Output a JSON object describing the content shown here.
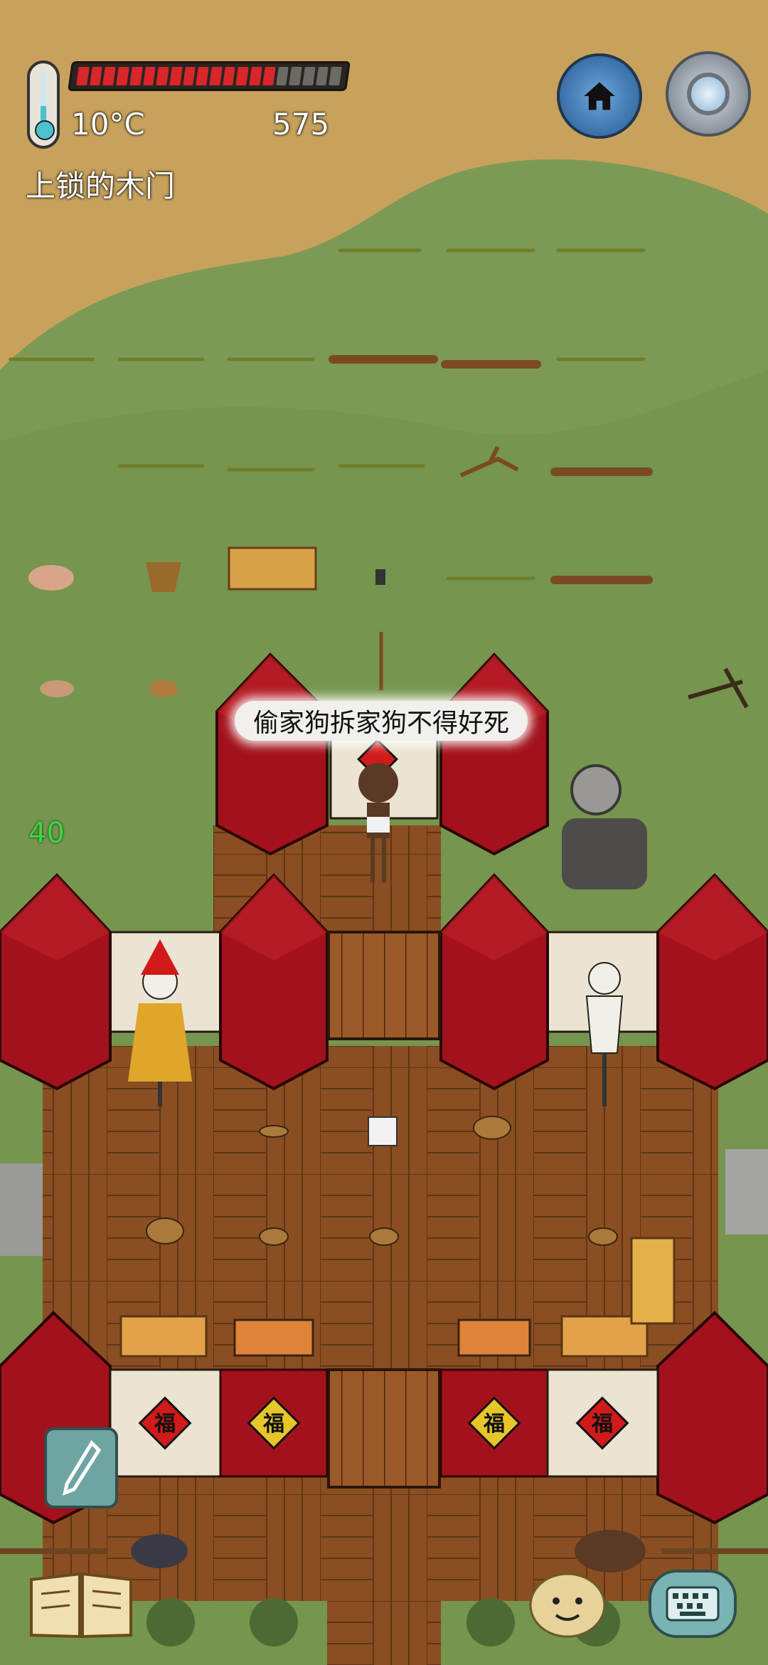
{
  "hud": {
    "temperature": "10°C",
    "score": "575",
    "object_name": "上锁的木门",
    "health_segments_total": 20,
    "health_segments_filled": 15,
    "health_color": "#d8262a",
    "health_empty_color": "#6c6a66"
  },
  "buttons": {
    "home_icon": "home-icon",
    "settings_icon": "gear-icon",
    "note_icon": "pencil-icon",
    "book_icon": "open-book-icon",
    "emote_icon": "potato-face-icon",
    "keyboard_icon": "keyboard-icon"
  },
  "game": {
    "speech_text": "偷家狗拆家狗不得好死",
    "counter": "40",
    "door_couplets": [
      "福",
      "福",
      "福",
      "福"
    ],
    "colors": {
      "straw": "#c8a25c",
      "grass": "#7c9a55",
      "wall_red": "#a3121c",
      "floor_wood": "#8a4e22",
      "wall_cream": "#ece4d3"
    }
  }
}
